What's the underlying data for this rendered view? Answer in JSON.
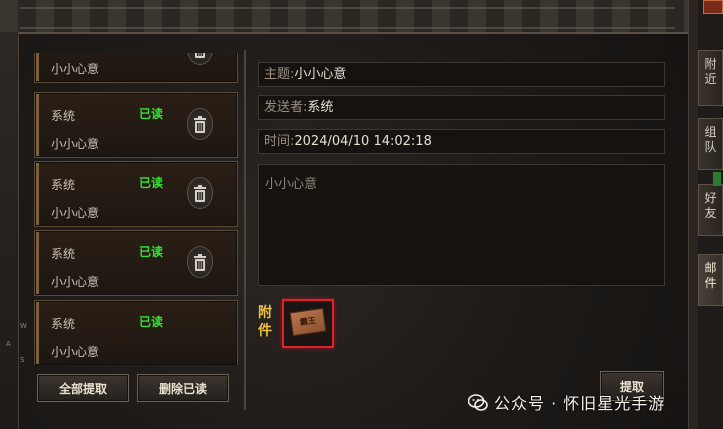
{
  "mail_list": [
    {
      "sender": "",
      "status": "",
      "subject": "小小心意"
    },
    {
      "sender": "系统",
      "status": "已读",
      "subject": "小小心意"
    },
    {
      "sender": "系统",
      "status": "已读",
      "subject": "小小心意"
    },
    {
      "sender": "系统",
      "status": "已读",
      "subject": "小小心意"
    },
    {
      "sender": "系统",
      "status": "已读",
      "subject": "小小心意"
    }
  ],
  "buttons": {
    "receive_all": "全部提取",
    "delete_read": "删除已读",
    "extract": "提取"
  },
  "detail": {
    "subject_label": "主题:",
    "subject_value": "小小心意",
    "sender_label": "发送者:",
    "sender_value": "系统",
    "time_label": "时间:",
    "time_value": "2024/04/10 14:02:18",
    "body": "小小心意"
  },
  "attachment": {
    "label": "附件",
    "item_text": "霸王"
  },
  "side_tabs": {
    "nearby": "附近",
    "team": "组队",
    "friend": "好友",
    "mail": "邮件"
  },
  "keys": {
    "w": "W",
    "a": "A",
    "d": "D",
    "s": "S"
  },
  "watermark": "公众号 · 怀旧星光手游",
  "colors": {
    "read_status": "#35e035",
    "attachment_label": "#f0c040",
    "attachment_highlight": "#e0202a"
  }
}
